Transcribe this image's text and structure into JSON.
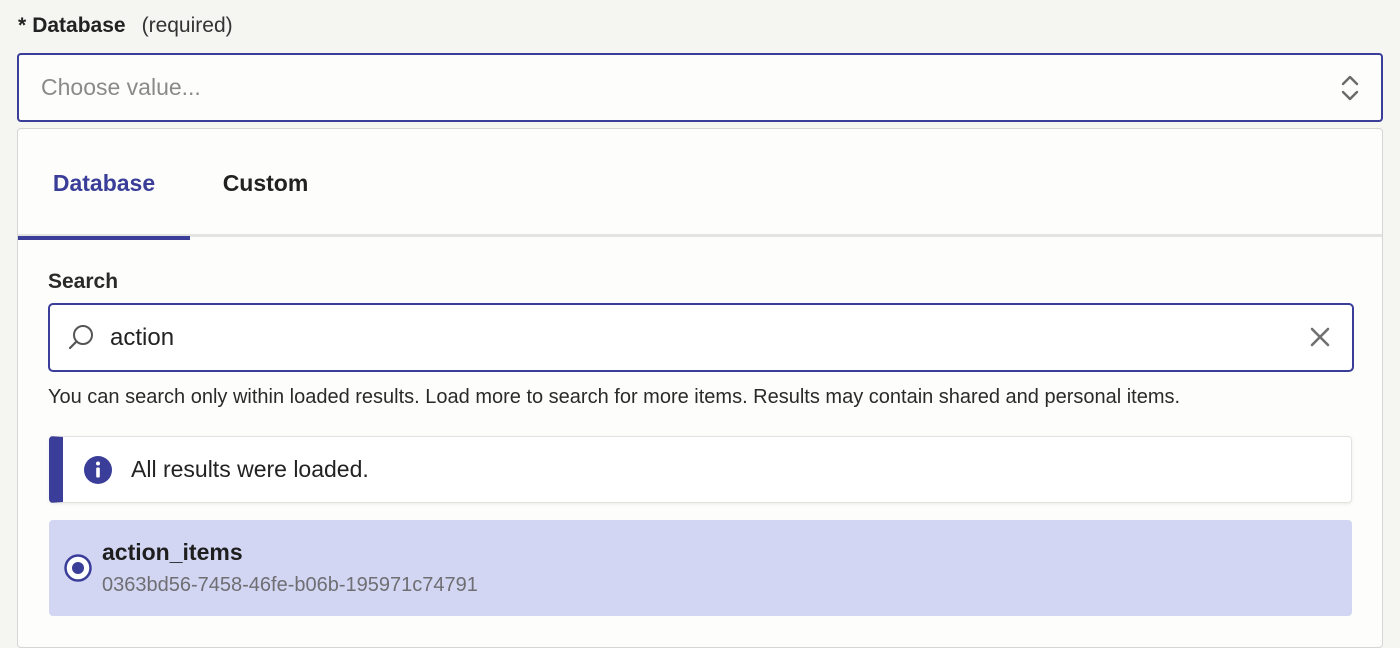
{
  "field": {
    "required_marker": "*",
    "label": "Database",
    "required_text": "(required)",
    "placeholder": "Choose value..."
  },
  "tabs": [
    {
      "label": "Database",
      "active": true
    },
    {
      "label": "Custom",
      "active": false
    }
  ],
  "search": {
    "label": "Search",
    "value": "action",
    "helper": "You can search only within loaded results. Load more to search for more items. Results may contain shared and personal items."
  },
  "info_banner": {
    "text": "All results were loaded."
  },
  "options": [
    {
      "title": "action_items",
      "id": "0363bd56-7458-46fe-b06b-195971c74791",
      "selected": true
    }
  ],
  "colors": {
    "accent": "#3a3e99",
    "selected_bg": "#d3d6f2",
    "page_bg": "#f5f5f2"
  },
  "icons": [
    "updown-chevron-icon",
    "search-icon",
    "clear-icon",
    "info-icon",
    "radio-selected-icon"
  ]
}
